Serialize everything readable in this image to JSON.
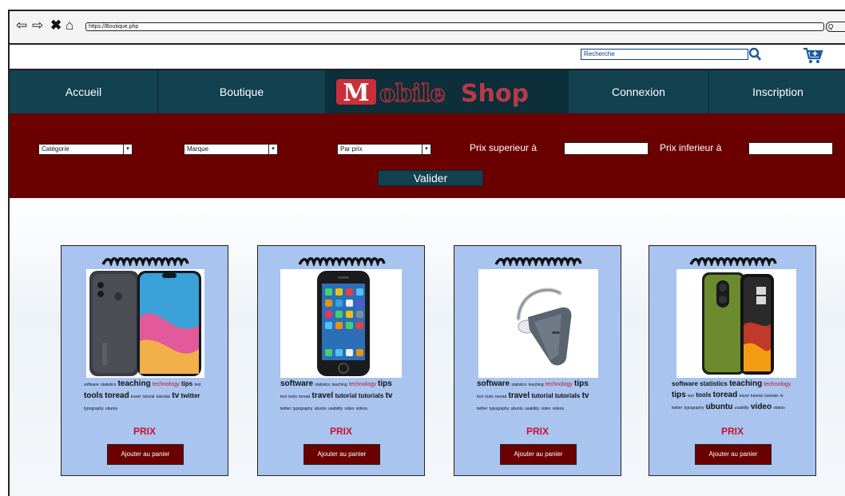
{
  "browser": {
    "url": "https://Boutique.php",
    "search_glyph": "Q"
  },
  "header": {
    "search_placeholder": "Recherche",
    "search_icon": "search-icon",
    "cart_icon": "cart-icon"
  },
  "nav": {
    "items": [
      "Accueil",
      "Boutique",
      "Connexion",
      "Inscription"
    ],
    "logo_text": "MobileShop"
  },
  "filters": {
    "category": "Catégorie",
    "brand": "Marque",
    "price_sort": "Par prix",
    "min_label": "Prix superieur à",
    "max_label": "Prix inferieur à",
    "submit": "Valider"
  },
  "colors": {
    "nav_bg": "#12414f",
    "filter_bg": "#6b0000",
    "card_bg": "#a9c4ee",
    "price": "#c8102e"
  },
  "products": [
    {
      "image": "smartphone-notch",
      "price_label": "PRIX",
      "button": "Ajouter au panier",
      "tags": [
        [
          "software",
          "tiny"
        ],
        [
          "statistics",
          "tiny"
        ],
        [
          "teaching",
          "big"
        ],
        [
          "technology",
          "red"
        ],
        [
          "tips",
          "b"
        ],
        [
          "text",
          "tiny"
        ],
        [
          "tools",
          "big"
        ],
        [
          "toread",
          "big"
        ],
        [
          "travel",
          "tiny"
        ],
        [
          "tutorial",
          "tiny"
        ],
        [
          "tutorials",
          "tiny"
        ],
        [
          "tv",
          "big"
        ],
        [
          "twitter",
          "b"
        ],
        [
          "typography",
          "tiny"
        ],
        [
          "ubuntu",
          "tiny"
        ]
      ]
    },
    {
      "image": "iphone",
      "price_label": "PRIX",
      "button": "Ajouter au panier",
      "tags": [
        [
          "software",
          "big"
        ],
        [
          "statistics",
          "tiny"
        ],
        [
          "teaching",
          "tiny"
        ],
        [
          "technology",
          "red"
        ],
        [
          "tips",
          "big"
        ],
        [
          "tool",
          "tiny"
        ],
        [
          "tools",
          "tiny"
        ],
        [
          "toread",
          "tiny"
        ],
        [
          "travel",
          "big"
        ],
        [
          "tutorial",
          "b"
        ],
        [
          "tutorials",
          "b"
        ],
        [
          "tv",
          "big"
        ],
        [
          "twitter",
          "tiny"
        ],
        [
          "typography",
          "tiny"
        ],
        [
          "ubuntu",
          "tiny"
        ],
        [
          "usability",
          "tiny"
        ],
        [
          "video",
          "tiny"
        ],
        [
          "videos",
          "tiny"
        ]
      ]
    },
    {
      "image": "bluetooth-headset",
      "price_label": "PRIX",
      "button": "Ajouter au panier",
      "tags": [
        [
          "software",
          "big"
        ],
        [
          "statistics",
          "tiny"
        ],
        [
          "teaching",
          "tiny"
        ],
        [
          "technology",
          "red"
        ],
        [
          "tips",
          "big"
        ],
        [
          "tool",
          "tiny"
        ],
        [
          "tools",
          "tiny"
        ],
        [
          "toread",
          "tiny"
        ],
        [
          "travel",
          "big"
        ],
        [
          "tutorial",
          "b"
        ],
        [
          "tutorials",
          "b"
        ],
        [
          "tv",
          "big"
        ],
        [
          "twitter",
          "tiny"
        ],
        [
          "typography",
          "tiny"
        ],
        [
          "ubuntu",
          "tiny"
        ],
        [
          "usability",
          "tiny"
        ],
        [
          "video",
          "tiny"
        ],
        [
          "videos",
          "tiny"
        ]
      ]
    },
    {
      "image": "green-phone-case",
      "price_label": "PRIX",
      "button": "Ajouter au panier",
      "tags": [
        [
          "software",
          "b"
        ],
        [
          "statistics",
          "b"
        ],
        [
          "teaching",
          "big"
        ],
        [
          "technology",
          "red"
        ],
        [
          "tips",
          "big"
        ],
        [
          "text",
          "tiny"
        ],
        [
          "tools",
          "b"
        ],
        [
          "toread",
          "big"
        ],
        [
          "travel",
          "tiny"
        ],
        [
          "tutorial",
          "tiny"
        ],
        [
          "tutorials",
          "tiny"
        ],
        [
          "tv",
          "tiny"
        ],
        [
          "twitter",
          "tiny"
        ],
        [
          "typography",
          "tiny"
        ],
        [
          "ubuntu",
          "big"
        ],
        [
          "usability",
          "tiny"
        ],
        [
          "video",
          "big"
        ],
        [
          "videos",
          "tiny"
        ]
      ]
    }
  ]
}
